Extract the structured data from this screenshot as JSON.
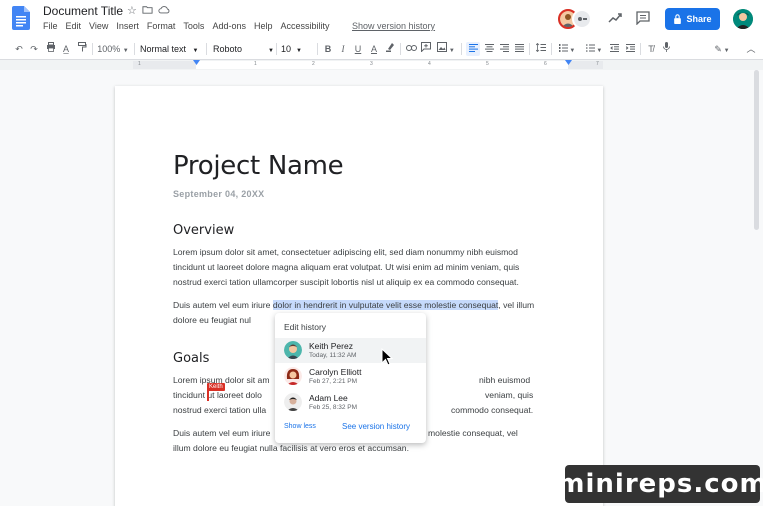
{
  "app": {
    "title": "Document Title",
    "menus": [
      "File",
      "Edit",
      "View",
      "Insert",
      "Format",
      "Tools",
      "Add-ons",
      "Help",
      "Accessibility"
    ],
    "version_link": "Show version history",
    "share_label": "Share"
  },
  "toolbar": {
    "zoom": "100%",
    "style": "Normal text",
    "font": "Roboto",
    "size": "10"
  },
  "ruler": {
    "numbers": [
      "1",
      "1",
      "2",
      "3",
      "4",
      "5",
      "6",
      "7"
    ]
  },
  "document": {
    "heading": "Project Name",
    "date": "September 04, 20XX",
    "overview_heading": "Overview",
    "overview_p1": "Lorem ipsum dolor sit amet, consectetuer adipiscing elit, sed diam nonummy nibh euismod tincidunt ut laoreet dolore magna aliquam erat volutpat. Ut wisi enim ad minim veniam, quis nostrud exerci tation ullamcorper suscipit lobortis nisl ut aliquip ex ea commodo consequat.",
    "overview_p2_pre": "Duis autem vel eum iriure ",
    "overview_p2_hl": "dolor in hendrerit in vulputate velit esse molestie consequat",
    "overview_p2_post": ", vel illum dolore eu feugiat nul",
    "goals_heading": "Goals",
    "goals_p1": "Lorem ipsum dolor sit am",
    "goals_p1_end_1": "nibh euismod",
    "goals_p1_l2": "tincidunt ut laoreet dolo",
    "goals_p1_end_2": "veniam, quis",
    "goals_p1_l3": "nostrud exerci tation ulla",
    "goals_p1_end_3": "commodo consequat.",
    "goals_p2_l1": "Duis autem vel eum iriure",
    "goals_p2_end_1": "molestie consequat, vel",
    "goals_p2_l2": "illum dolore eu feugiat nulla facilisis at vero eros et accumsan.",
    "collaborator_label": "Keith"
  },
  "edit_history": {
    "title": "Edit history",
    "entries": [
      {
        "name": "Keith Perez",
        "time": "Today, 11:32 AM"
      },
      {
        "name": "Carolyn Elliott",
        "time": "Feb 27, 2:21 PM"
      },
      {
        "name": "Adam Lee",
        "time": "Feb 25, 8:32 PM"
      }
    ],
    "show_less": "Show less",
    "see_version": "See version history"
  },
  "watermark": "minireps.com",
  "colors": {
    "accent": "#1a73e8",
    "highlight": "#c6dafc",
    "collaborator": "#d93025"
  }
}
